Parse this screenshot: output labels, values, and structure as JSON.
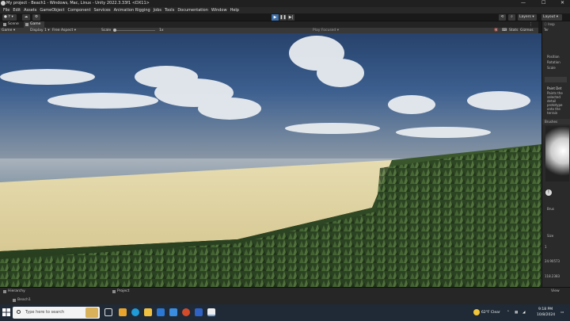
{
  "window": {
    "title": "My project - Beach1 - Windows, Mac, Linux - Unity 2022.3.33f1 <DX11>",
    "controls": [
      "—",
      "☐",
      "✕"
    ]
  },
  "menu": [
    "File",
    "Edit",
    "Assets",
    "GameObject",
    "Component",
    "Services",
    "Animation Rigging",
    "Jobs",
    "Tools",
    "Documentation",
    "Window",
    "Help"
  ],
  "toolbar": {
    "account": "Y",
    "layers": "Layers",
    "layout": "Layout"
  },
  "tabs": {
    "scene": "Scene",
    "game": "Game"
  },
  "game_bar": {
    "mode": "Game",
    "display": "Display 1",
    "aspect": "Free Aspect",
    "scale_label": "Scale",
    "scale_value": "1x",
    "play_focused": "Play Focused",
    "stats": "Stats",
    "gizmos": "Gizmos"
  },
  "inspector": {
    "tab_label": "Insp",
    "tabs_short": "Ter",
    "fields": [
      "Position",
      "Rotation",
      "Scale"
    ],
    "tool_title": "Paint Det",
    "tool_desc": [
      "Paints the",
      "selected",
      "detail",
      "prototype",
      "onto the",
      "terrain"
    ],
    "brushes_header": "Brushes",
    "brush_label": "Brus",
    "size_label": "Size",
    "values": [
      "1",
      "24.90573",
      "118.2383"
    ],
    "brush_size": "Brush Size",
    "brush_sc": "Brush Sca",
    "paint": "Pain",
    "view_label": "View"
  },
  "bottom": {
    "hierarchy": "Hierarchy",
    "project": "Project",
    "scene_item": "Beach1"
  },
  "taskbar": {
    "search_placeholder": "Type here to search",
    "weather": "62°F  Clear",
    "time": "9:18 PM",
    "date": "10/8/2024"
  },
  "colors": {
    "accent_play": "#3f6fa8",
    "panel_bg": "#282828",
    "taskbar_bg": "#1f2a36"
  }
}
